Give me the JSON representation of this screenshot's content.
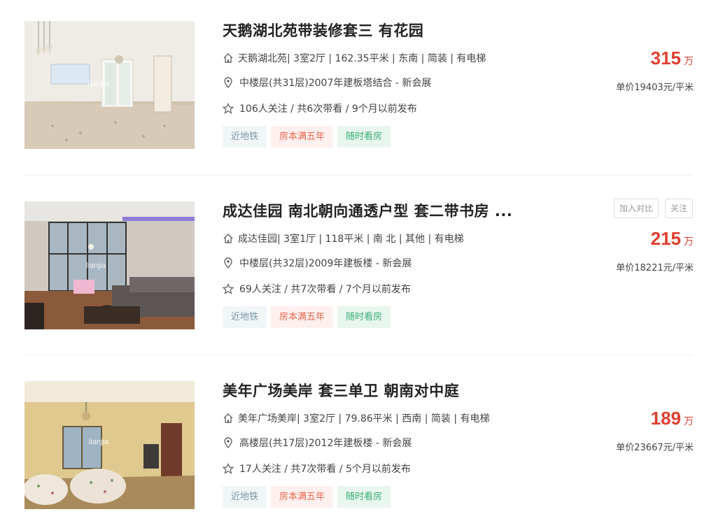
{
  "colors": {
    "price": "#e03f2f",
    "tag_subway_bg": "#f0f5f7",
    "tag_five_bg": "#fdf0ee",
    "tag_visit_bg": "#e8f6ee"
  },
  "icons": {
    "house": "house-icon",
    "location": "location-pin-icon",
    "follow": "star-icon"
  },
  "listings": [
    {
      "title": "天鹅湖北苑带装修套三 有花园",
      "community": "天鹅湖北苑",
      "house_info": " | 3室2厅 | 162.35平米 | 东南 | 简装 | 有电梯",
      "position_info": "中楼层(共31层)2007年建板塔结合 - 新会展",
      "follow_info": "106人关注 / 共6次带看 / 9个月以前发布",
      "tags": [
        "近地铁",
        "房本满五年",
        "随时看房"
      ],
      "price": "315",
      "price_unit": "万",
      "unit_price": "单价19403元/平米",
      "image_watermark": "lianjia"
    },
    {
      "title": "成达佳园 南北朝向通透户型 套二带书房 ...",
      "community": "成达佳园",
      "house_info": " | 3室1厅 | 118平米 | 南 北 | 其他 | 有电梯",
      "position_info": "中楼层(共32层)2009年建板楼 - 新会展",
      "follow_info": "69人关注 / 共7次带看 / 7个月以前发布",
      "tags": [
        "近地铁",
        "房本满五年",
        "随时看房"
      ],
      "price": "215",
      "price_unit": "万",
      "unit_price": "单价18221元/平米",
      "actions": [
        "加入对比",
        "关注"
      ],
      "image_watermark": "lianjia"
    },
    {
      "title": "美年广场美岸 套三单卫 朝南对中庭",
      "community": "美年广场美岸",
      "house_info": " | 3室2厅 | 79.86平米 | 西南 | 简装 | 有电梯",
      "position_info": "高楼层(共17层)2012年建板楼 - 新会展",
      "follow_info": "17人关注 / 共7次带看 / 5个月以前发布",
      "tags": [
        "近地铁",
        "房本满五年",
        "随时看房"
      ],
      "price": "189",
      "price_unit": "万",
      "unit_price": "单价23667元/平米",
      "image_watermark": "lianjia"
    }
  ]
}
